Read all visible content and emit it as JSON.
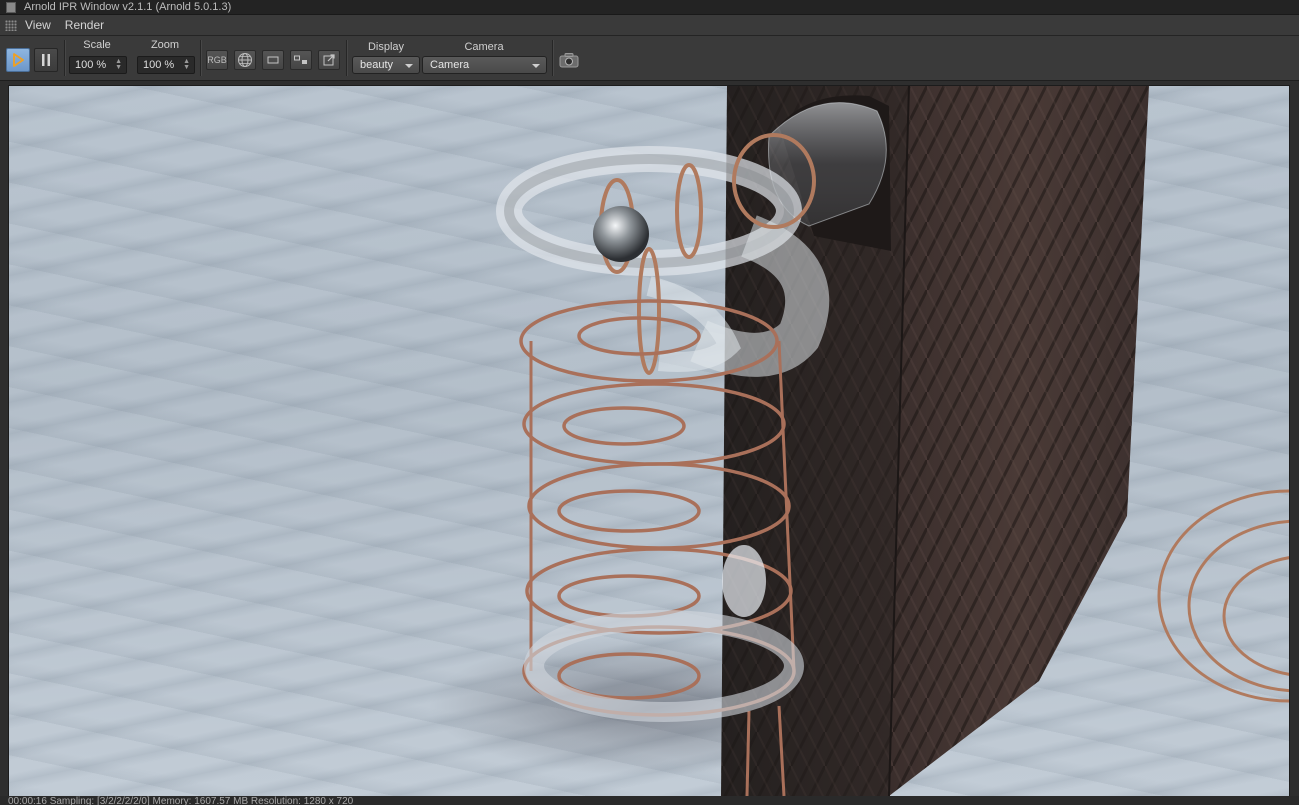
{
  "window": {
    "title": "Arnold IPR Window v2.1.1 (Arnold 5.0.1.3)"
  },
  "menu": {
    "items": [
      {
        "label": "View"
      },
      {
        "label": "Render"
      }
    ]
  },
  "toolbar": {
    "play_icon": "play-icon",
    "pause_icon": "pause-icon",
    "scale": {
      "label": "Scale",
      "value": "100 %"
    },
    "zoom": {
      "label": "Zoom",
      "value": "100 %"
    },
    "rgb_label": "RGB",
    "display": {
      "label": "Display",
      "value": "beauty"
    },
    "camera": {
      "label": "Camera",
      "value": "Camera"
    },
    "accent_color": "#f0a020"
  },
  "status": {
    "text": "00:00:16  Sampling: [3/2/2/2/2/0]  Memory: 1607.57 MB  Resolution: 1280 x 720"
  }
}
